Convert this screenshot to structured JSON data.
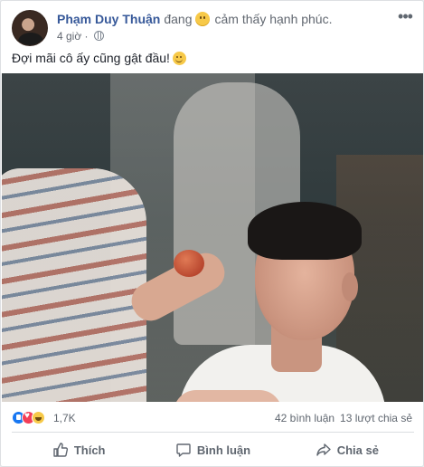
{
  "post": {
    "author": "Phạm Duy Thuận",
    "verb": "đang",
    "feeling_icon": "slightly-smiling-face-icon",
    "feeling": "cảm thấy hạnh phúc.",
    "time": "4 giờ",
    "privacy_icon": "globe-icon",
    "status_text": "Đợi mãi cô ấy cũng gật đầu!",
    "status_emoji": "smile-emoji-icon"
  },
  "reactions": {
    "icons": [
      "like-icon",
      "love-icon",
      "haha-icon"
    ],
    "count": "1,7K",
    "comments": "42 bình luận",
    "shares": "13 lượt chia sẻ"
  },
  "actions": {
    "like": "Thích",
    "comment": "Bình luận",
    "share": "Chia sẻ"
  },
  "colors": {
    "author_link": "#365899",
    "secondary_text": "#606770",
    "like_blue": "#1877f2",
    "love_red": "#f33e58"
  }
}
